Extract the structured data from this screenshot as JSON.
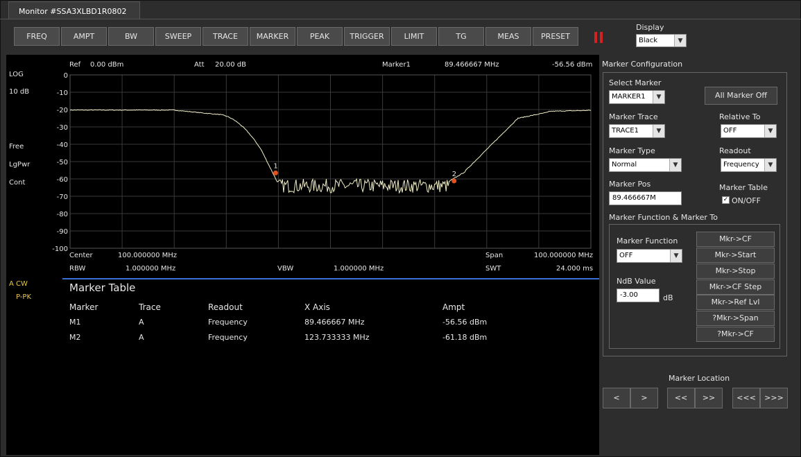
{
  "window": {
    "tab_title": "Monitor #SSA3XLBD1R0802"
  },
  "menu": [
    "FREQ",
    "AMPT",
    "BW",
    "SWEEP",
    "TRACE",
    "MARKER",
    "PEAK",
    "TRIGGER",
    "LIMIT",
    "TG",
    "MEAS",
    "PRESET"
  ],
  "display": {
    "label": "Display",
    "value": "Black"
  },
  "screen": {
    "ref_label": "Ref",
    "ref_value": "0.00 dBm",
    "att_label": "Att",
    "att_value": "20.00 dB",
    "marker_label": "Marker1",
    "marker_freq": "89.466667 MHz",
    "marker_ampl": "-56.56 dBm",
    "scale_type": "LOG",
    "scale_div": "10 dB",
    "status": [
      "Free",
      "LgPwr",
      "Cont"
    ],
    "trace_a": "A CW",
    "trace_det": "P-PK",
    "y_ticks": [
      "0",
      "-10",
      "-20",
      "-30",
      "-40",
      "-50",
      "-60",
      "-70",
      "-80",
      "-90",
      "-100"
    ],
    "center_label": "Center",
    "center_value": "100.000000 MHz",
    "span_label": "Span",
    "span_value": "100.000000 MHz",
    "rbw_label": "RBW",
    "rbw_value": "1.000000 MHz",
    "vbw_label": "VBW",
    "vbw_value": "1.000000 MHz",
    "swt_label": "SWT",
    "swt_value": "24.000 ms",
    "marker_points": [
      {
        "label": "1",
        "x": 89.466667,
        "y": -56.56
      },
      {
        "label": "2",
        "x": 123.733333,
        "y": -61.18
      }
    ]
  },
  "marker_table": {
    "title": "Marker Table",
    "headers": [
      "Marker",
      "Trace",
      "Readout",
      "X Axis",
      "Ampt"
    ],
    "rows": [
      [
        "M1",
        "A",
        "Frequency",
        "89.466667 MHz",
        "-56.56 dBm"
      ],
      [
        "M2",
        "A",
        "Frequency",
        "123.733333 MHz",
        "-61.18 dBm"
      ]
    ]
  },
  "config": {
    "title": "Marker Configuration",
    "select_marker_label": "Select Marker",
    "select_marker_value": "MARKER1",
    "all_off": "All Marker Off",
    "marker_trace_label": "Marker Trace",
    "marker_trace_value": "TRACE1",
    "relative_to_label": "Relative To",
    "relative_to_value": "OFF",
    "marker_type_label": "Marker Type",
    "marker_type_value": "Normal",
    "readout_label": "Readout",
    "readout_value": "Frequency",
    "marker_pos_label": "Marker Pos",
    "marker_pos_value": "89.466667M",
    "marker_table_label": "Marker Table",
    "marker_table_check": "ON/OFF",
    "function_group_label": "Marker Function & Marker To",
    "marker_function_label": "Marker Function",
    "marker_function_value": "OFF",
    "ndb_label": "NdB Value",
    "ndb_value": "-3.00",
    "ndb_unit": "dB",
    "mkr_buttons": [
      "Mkr->CF",
      "Mkr->Start",
      "Mkr->Stop",
      "Mkr->CF Step",
      "Mkr->Ref Lvl",
      "?Mkr->Span",
      "?Mkr->CF"
    ]
  },
  "location": {
    "label": "Marker Location",
    "buttons": [
      "<",
      ">",
      "<<",
      ">>",
      "<<<",
      ">>>"
    ]
  },
  "colors": {
    "trace": "#f2f0c8",
    "marker": "#e05020",
    "accent_line": "#3b6fd6",
    "pause": "#d32020"
  }
}
